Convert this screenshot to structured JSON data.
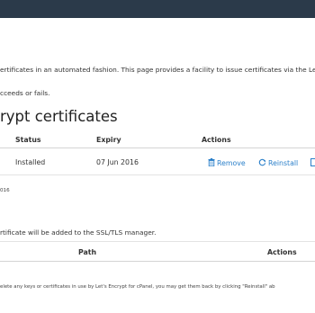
{
  "intro": {
    "line1": "ertificates in an automated fashion. This page provides a facility to issue certificates via the Let's",
    "line2": "cceeds or fails."
  },
  "installed": {
    "heading": "rypt certificates",
    "columns": {
      "status": "Status",
      "expiry": "Expiry",
      "actions": "Actions"
    },
    "row": {
      "status": "Installed",
      "expiry": "07 Jun 2016",
      "remove_label": "Remove",
      "reinstall_label": "Reinstall"
    },
    "footnote": "016"
  },
  "issue": {
    "text": "rtificate will be added to the SSL/TLS manager.",
    "columns": {
      "path": "Path",
      "actions": "Actions"
    },
    "note": "elete any keys or certificates in use by Let's Encrypt for cPanel, you may get them back by clicking \"Reinstall\" ab"
  },
  "icons": {
    "remove": "trash-icon",
    "reinstall": "refresh-icon",
    "more": "document-icon"
  },
  "colors": {
    "link": "#2a7fc9",
    "topbar": "#2b3a4a"
  }
}
